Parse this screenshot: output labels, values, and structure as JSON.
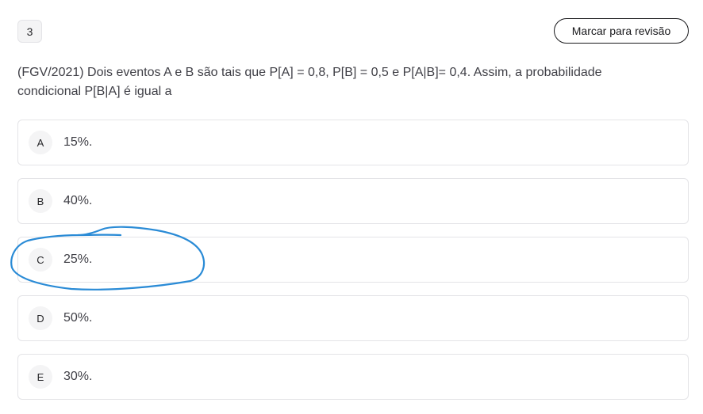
{
  "question": {
    "number": "3",
    "review_label": "Marcar para revisão",
    "text": "(FGV/2021) Dois eventos A e B são tais que P[A] = 0,8, P[B] = 0,5 e P[A|B]= 0,4. Assim, a probabilidade condicional P[B|A] é igual a"
  },
  "options": [
    {
      "letter": "A",
      "text": "15%."
    },
    {
      "letter": "B",
      "text": "40%."
    },
    {
      "letter": "C",
      "text": "25%."
    },
    {
      "letter": "D",
      "text": "50%."
    },
    {
      "letter": "E",
      "text": "30%."
    }
  ],
  "annotation": {
    "color": "#2a8bd6",
    "marks": "option C"
  }
}
